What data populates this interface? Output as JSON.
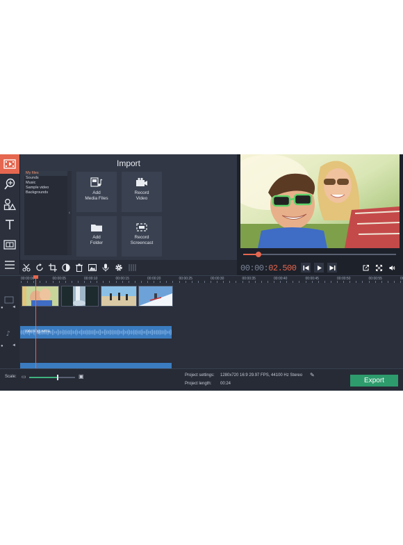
{
  "import": {
    "title": "Import",
    "categories": [
      "My files",
      "Sounds",
      "Music",
      "Sample video",
      "Backgrounds"
    ],
    "tiles": [
      {
        "label": "Add\nMedia Files",
        "icon": "add-media-icon"
      },
      {
        "label": "Record\nVideo",
        "icon": "camera-icon"
      },
      {
        "label": "Add\nFolder",
        "icon": "folder-icon"
      },
      {
        "label": "Record\nScreencast",
        "icon": "screencast-icon"
      }
    ]
  },
  "rail": {
    "items": [
      "import-icon",
      "filters-icon",
      "stickers-icon",
      "titles-icon",
      "transitions-icon",
      "more-icon"
    ],
    "active": 0
  },
  "toolbar": {
    "tools": [
      "cut-icon",
      "rotate-icon",
      "crop-icon",
      "color-adjust-icon",
      "delete-icon",
      "image-icon",
      "microphone-icon",
      "settings-icon",
      "equalizer-icon"
    ]
  },
  "player": {
    "timecode_dim": "00:00:",
    "timecode_hi": "02.500",
    "progress_fraction": 0.1
  },
  "ruler": {
    "ticks": [
      "00:00:00",
      "00:00:05",
      "00:00:10",
      "00:00:15",
      "00:00:20",
      "00:00:25",
      "00:00:30",
      "00:00:35",
      "00:00:40",
      "00:00:45",
      "00:00:50",
      "00:00:55",
      "00"
    ]
  },
  "timeline": {
    "audio_clip": "morning.wma"
  },
  "status": {
    "scale_label": "Scale:",
    "scale_fraction": 0.62,
    "settings_label": "Project settings:",
    "settings_value": "1280x720 16:9 29.97 FPS, 44100 Hz Stereo",
    "length_label": "Project length:",
    "length_value": "00:24",
    "export_label": "Export"
  },
  "colors": {
    "accent": "#e5674f",
    "export": "#2e9b6d",
    "audio": "#3b7cc0"
  }
}
